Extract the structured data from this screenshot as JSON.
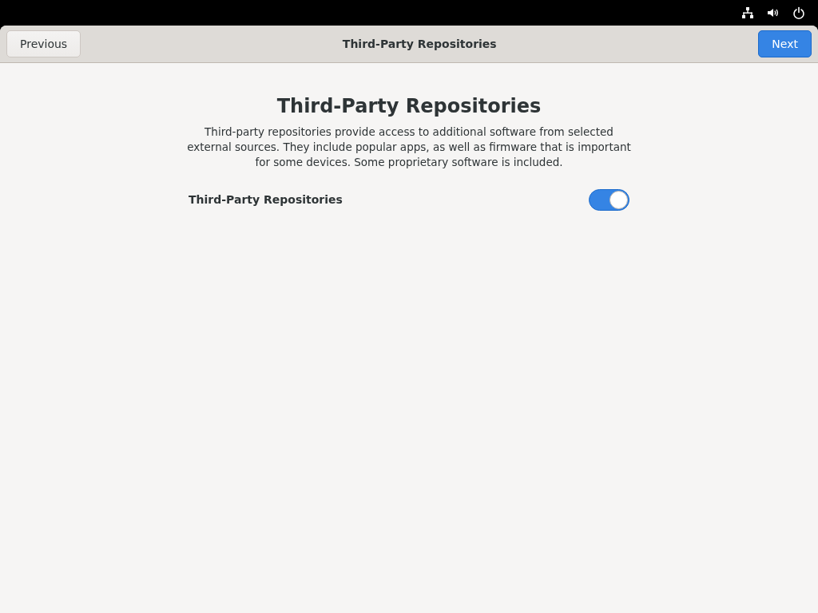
{
  "header_bar": {
    "previous_button": "Previous",
    "title": "Third-Party Repositories",
    "next_button": "Next"
  },
  "page": {
    "heading": "Third-Party Repositories",
    "description": "Third-party repositories provide access to additional software from selected external sources. They include popular apps, as well as firmware that is important for some devices. Some proprietary software is included.",
    "setting": {
      "label": "Third-Party Repositories",
      "on": true
    }
  }
}
